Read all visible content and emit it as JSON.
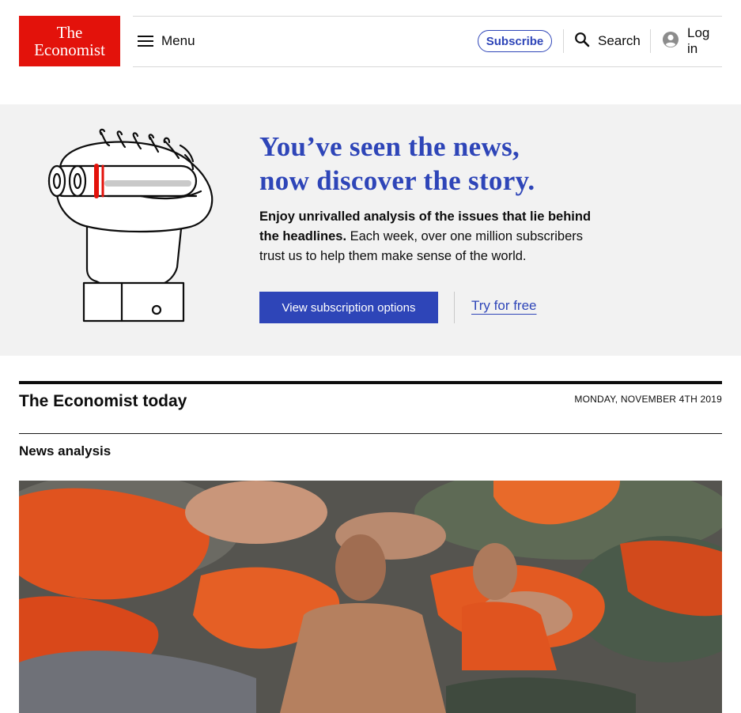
{
  "header": {
    "logo_line1": "The",
    "logo_line2": "Economist",
    "menu_label": "Menu",
    "subscribe_label": "Subscribe",
    "search_label": "Search",
    "login_label": "Log in"
  },
  "promo": {
    "headline_line1": "You’ve seen the news,",
    "headline_line2": "now discover the story.",
    "body_bold": "Enjoy unrivalled analysis of the issues that lie behind the headlines.",
    "body_rest": " Each week, over one million subscribers trust us to help them make sense of the world.",
    "cta_primary": "View subscription options",
    "cta_secondary": "Try for free"
  },
  "today": {
    "title": "The Economist today",
    "date": "MONDAY, NOVEMBER 4TH 2019",
    "section_label": "News analysis"
  },
  "colors": {
    "brand_red": "#e3120b",
    "accent_blue": "#2e45b8",
    "promo_bg": "#f2f2f2"
  },
  "icons": {
    "menu": "hamburger-icon",
    "search": "search-icon",
    "account": "account-icon"
  }
}
